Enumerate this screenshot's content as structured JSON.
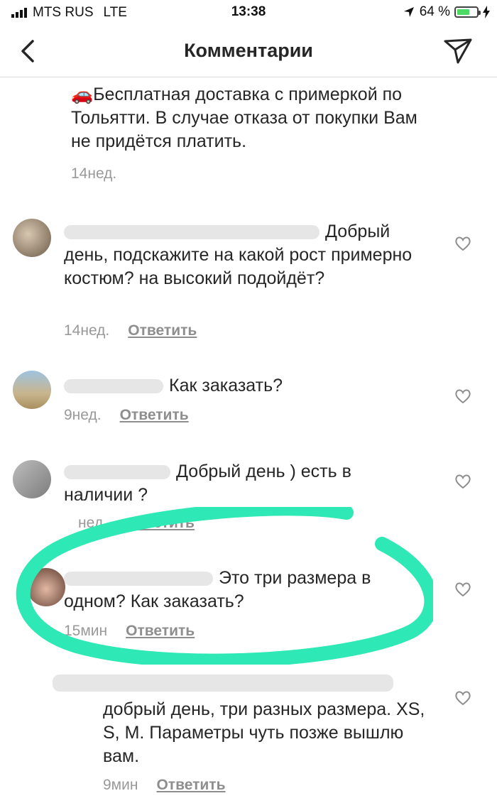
{
  "status_bar": {
    "carrier": "MTS RUS",
    "network": "LTE",
    "time": "13:38",
    "battery": "64 %",
    "battery_level": 0.64
  },
  "header": {
    "title": "Комментарии"
  },
  "comments": [
    {
      "text": "🚗Бесплатная доставка с примеркой по Тольятти. В случае отказа от покупки Вам не придётся платить.",
      "time": "14нед.",
      "reply": ""
    },
    {
      "text": "Добрый день, подскажите на какой рост примерно костюм? на высокий подойдёт?",
      "time": "14нед.",
      "reply": "Ответить"
    },
    {
      "text": "Как заказать?",
      "time": "9нед.",
      "reply": "Ответить"
    },
    {
      "text": "Добрый день ) есть в наличии ?",
      "time": "нед.",
      "reply": "Ответить"
    },
    {
      "text": "Это три размера в одном? Как заказать?",
      "time": "15мин",
      "reply": "Ответить"
    },
    {
      "text": "добрый день, три разных размера. XS, S, M. Параметры чуть позже вышлю вам.",
      "time": "9мин",
      "reply": "Ответить"
    }
  ],
  "colors": {
    "highlight": "#2ee8b6",
    "text": "#262626",
    "meta": "#999999"
  },
  "icons": [
    "back-chevron-icon",
    "send-icon",
    "heart-icon",
    "location-arrow-icon",
    "charging-icon"
  ]
}
